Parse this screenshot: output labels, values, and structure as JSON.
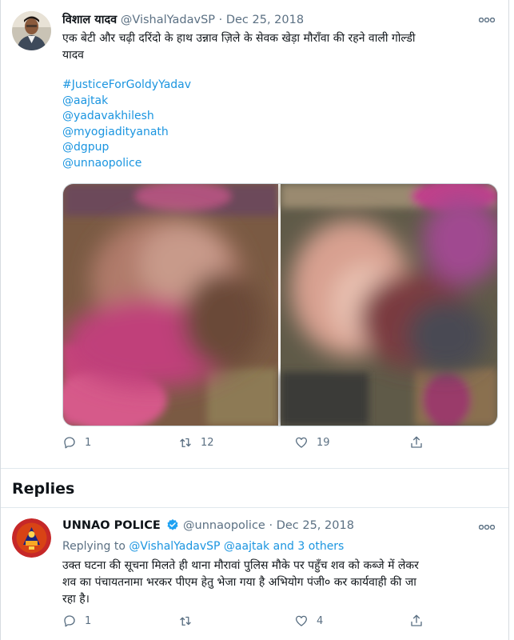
{
  "tweet": {
    "author_name": "विशाल यादव",
    "handle": "@VishalYadavSP",
    "separator": "·",
    "date": "Dec 25, 2018",
    "text_lines": [
      "एक बेटी और चढ़ी दरिंदो के हाथ उन्नाव ज़िले के सेवक खेड़ा मौरॉंवा की रहने वाली गोल्डी",
      "यादव"
    ],
    "hashtag": "#JusticeForGoldyYadav",
    "mentions": [
      "@aajtak",
      "@yadavakhilesh",
      "@myogiadityanath",
      "@dgpup",
      "@unnaopolice"
    ],
    "actions": {
      "replies": "1",
      "retweets": "12",
      "likes": "19"
    }
  },
  "replies_header": "Replies",
  "reply": {
    "author_name": "UNNAO POLICE",
    "handle": "@unnaopolice",
    "separator": "·",
    "date": "Dec 25, 2018",
    "replying_prefix": "Replying to",
    "replying_handles": "@VishalYadavSP @aajtak",
    "replying_and": "and",
    "replying_others": "3 others",
    "text_lines": [
      "उक्त घटना की सूचना मिलते ही थाना मौरावां पुलिस मौके पर पहुँच शव को कब्जे में लेकर",
      "शव का पंचायतनामा भरकर पीएम हेतु भेजा गया है अभियोग पंजी० कर कार्यवाही की जा",
      "रहा है।"
    ],
    "actions": {
      "replies": "1",
      "retweets": "",
      "likes": "4"
    }
  },
  "colors": {
    "link": "#1b95e0",
    "secondary_text": "#5b7083",
    "verified": "#1da1f2",
    "divider": "#e1e8ed"
  },
  "icons": [
    "more-icon",
    "reply-icon",
    "retweet-icon",
    "like-icon",
    "share-icon",
    "verified-badge-icon"
  ]
}
